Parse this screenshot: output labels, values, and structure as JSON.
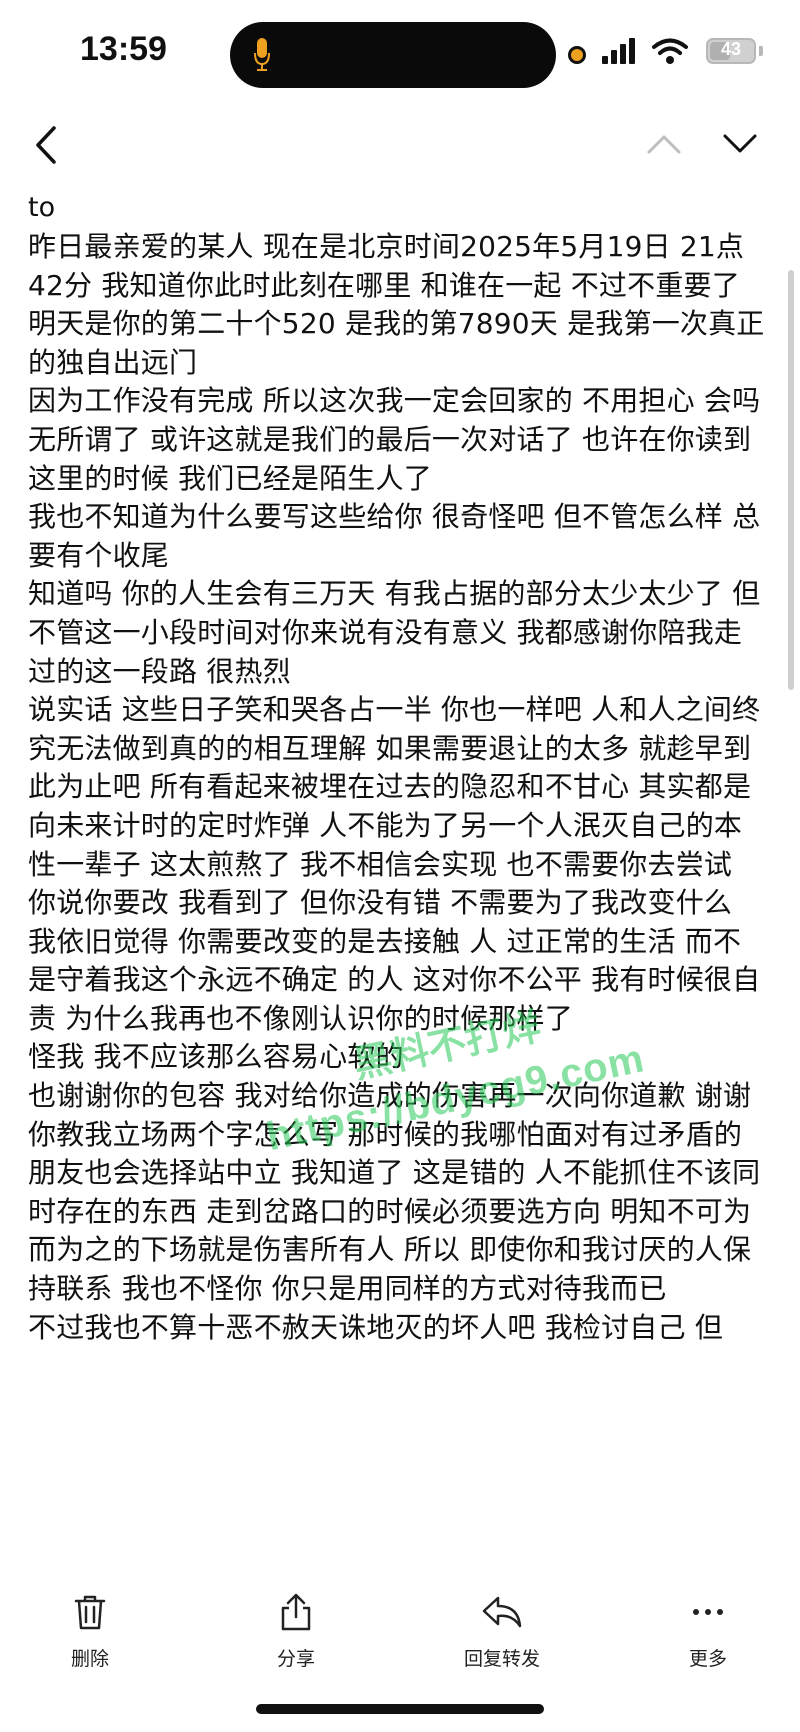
{
  "status_bar": {
    "time": "13:59",
    "battery_level": "43"
  },
  "message": {
    "recipient": "to",
    "paragraphs": [
      "昨日最亲爱的某人 现在是北京时间2025年5月19日 21点42分 我知道你此时此刻在哪里 和谁在一起 不过不重要了 明天是你的第二十个520 是我的第7890天 是我第一次真正的独自出远门",
      "因为工作没有完成 所以这次我一定会回家的 不用担心 会吗 无所谓了 或许这就是我们的最后一次对话了 也许在你读到这里的时候 我们已经是陌生人了",
      "我也不知道为什么要写这些给你 很奇怪吧 但不管怎么样 总要有个收尾",
      "知道吗 你的人生会有三万天 有我占据的部分太少太少了 但不管这一小段时间对你来说有没有意义 我都感谢你陪我走过的这一段路 很热烈",
      "说实话 这些日子笑和哭各占一半 你也一样吧 人和人之间终究无法做到真的的相互理解 如果需要退让的太多 就趁早到此为止吧 所有看起来被埋在过去的隐忍和不甘心 其实都是向未来计时的定时炸弹 人不能为了另一个人泯灭自己的本性一辈子 这太煎熬了 我不相信会实现 也不需要你去尝试",
      "你说你要改 我看到了 但你没有错 不需要为了我改变什么 我依旧觉得 你需要改变的是去接触 人 过正常的生活 而不是守着我这个永远不确定 的人 这对你不公平 我有时候很自责 为什么我再也不像刚认识你的时候那样了",
      "怪我 我不应该那么容易心软的",
      "也谢谢你的包容 我对给你造成的伤害再一次向你道歉 谢谢你教我立场两个字怎么写 那时候的我哪怕面对有过矛盾的朋友也会选择站中立 我知道了 这是错的 人不能抓住不该同时存在的东西 走到岔路口的时候必须要选方向 明知不可为而为之的下场就是伤害所有人 所以 即使你和我讨厌的人保持联系 我也不怪你 你只是用同样的方式对待我而已",
      "不过我也不算十恶不赦天诛地灭的坏人吧 我检讨自己 但"
    ]
  },
  "watermark": {
    "line1": "黑料不打烊",
    "line2": "https://bdycg9.com"
  },
  "toolbar": {
    "delete_label": "删除",
    "share_label": "分享",
    "reply_forward_label": "回复转发",
    "more_label": "更多"
  },
  "icons": {
    "back": "chevron-left-icon",
    "prev": "chevron-up-icon",
    "next": "chevron-down-icon",
    "delete": "trash-icon",
    "share": "share-icon",
    "reply": "reply-icon",
    "more": "more-icon"
  },
  "colors": {
    "watermark": "#28c85a",
    "privacy_indicator": "#f0a020"
  }
}
